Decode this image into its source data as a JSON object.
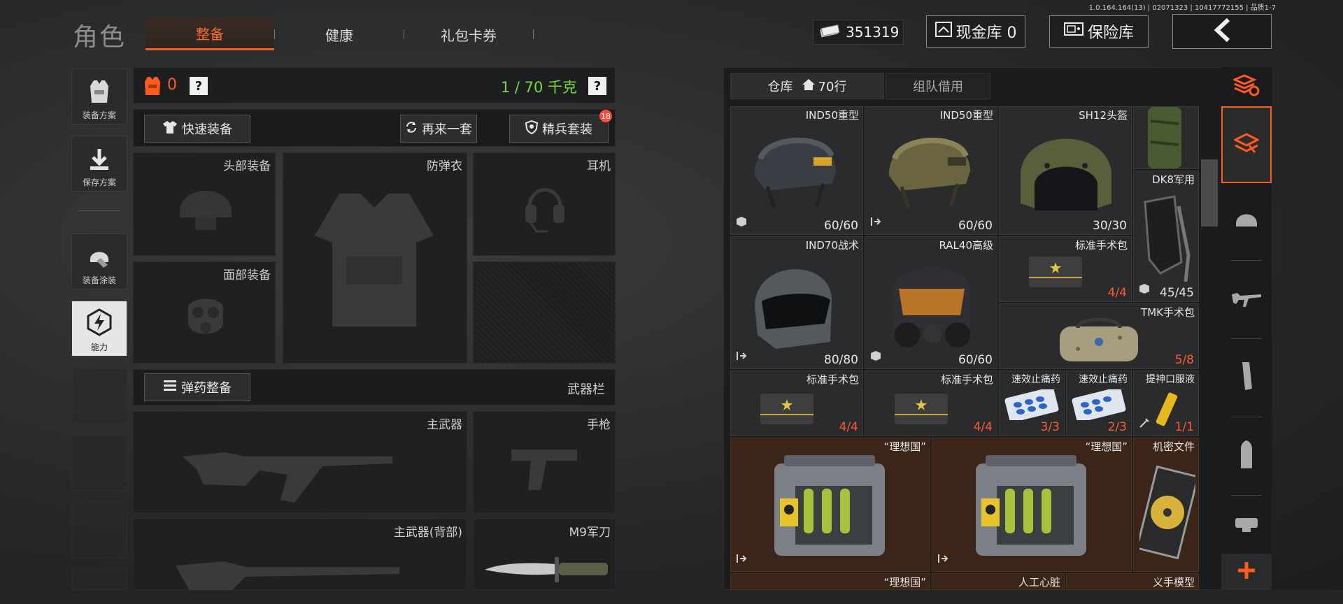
{
  "version": "1.0.164.164(13) | 02071323 | 10417772155 | 品质1-7",
  "header": {
    "title": "角色",
    "tabs": [
      {
        "label": "整备",
        "active": true
      },
      {
        "label": "健康",
        "active": false
      },
      {
        "label": "礼包卡券",
        "active": false
      }
    ],
    "money": "351319",
    "cash_vault": "现金库 0",
    "safe_vault": "保险库"
  },
  "sidebar": {
    "items": [
      {
        "label": "装备方案",
        "icon": "vest-icon"
      },
      {
        "label": "保存方案",
        "icon": "download-icon"
      },
      {
        "label": "装备涂装",
        "icon": "paint-helmet-icon"
      },
      {
        "label": "能力",
        "icon": "ability-icon"
      }
    ]
  },
  "loadout": {
    "armor_count": "0",
    "weight": "1 / 70 千克",
    "help": "?",
    "quick_equip": "快速装备",
    "another_set": "再来一套",
    "elite_set": "精兵套装",
    "elite_badge": "18",
    "ammo_prep": "弹药整备",
    "weapon_bar": "武器栏",
    "slots": {
      "head": "头部装备",
      "armor": "防弹衣",
      "ear": "耳机",
      "face": "面部装备",
      "primary": "主武器",
      "pistol": "手枪",
      "primary_back": "主武器(背部)",
      "knife": "M9军刀"
    }
  },
  "warehouse": {
    "tab_label": "仓库",
    "rows": "70行",
    "team_borrow": "组队借用",
    "items": [
      {
        "name": "IND50重型",
        "count": "60/60",
        "icon": "helmet-icon",
        "tag": "box-icon"
      },
      {
        "name": "IND50重型",
        "count": "60/60",
        "icon": "helmet-icon",
        "tag": "export-icon"
      },
      {
        "name": "SH12头盔",
        "count": "30/30",
        "icon": "helmet-icon"
      },
      {
        "name": "DK8军用",
        "count": "45/45",
        "icon": "face-shield-icon",
        "tag": "box-icon"
      },
      {
        "name": "IND70战术",
        "count": "80/80",
        "icon": "helmet-icon",
        "tag": "export-icon"
      },
      {
        "name": "RAL40高级",
        "count": "60/60",
        "icon": "gas-mask-icon",
        "tag": "box-icon"
      },
      {
        "name": "标准手术包",
        "count": "4/4",
        "icon": "medkit-icon"
      },
      {
        "name": "TMK手术包",
        "count": "5/8",
        "icon": "medbag-icon"
      },
      {
        "name": "标准手术包",
        "count": "4/4",
        "icon": "medkit-icon"
      },
      {
        "name": "标准手术包",
        "count": "4/4",
        "icon": "medkit-icon"
      },
      {
        "name": "速效止痛药",
        "count": "3/3",
        "icon": "pills-icon"
      },
      {
        "name": "速效止痛药",
        "count": "2/3",
        "icon": "pills-icon"
      },
      {
        "name": "提神口服液",
        "count": "1/1",
        "icon": "vial-icon",
        "tag": "syringe-icon"
      },
      {
        "name": "“理想国”",
        "icon": "biohazard-case-icon",
        "tag": "export-icon"
      },
      {
        "name": "“理想国”",
        "icon": "biohazard-case-icon",
        "tag": "export-icon"
      },
      {
        "name": "机密文件",
        "icon": "disc-icon"
      },
      {
        "name": "“理想国”",
        "icon": "case-icon"
      },
      {
        "name": "人工心脏",
        "icon": "heart-icon"
      },
      {
        "name": "义手模型",
        "icon": "hand-icon"
      }
    ]
  },
  "colors": {
    "accent": "#ff5a1f",
    "weight_green": "#7ad93a",
    "count_red": "#ff5a30",
    "rare_bg": "#3b2418"
  }
}
